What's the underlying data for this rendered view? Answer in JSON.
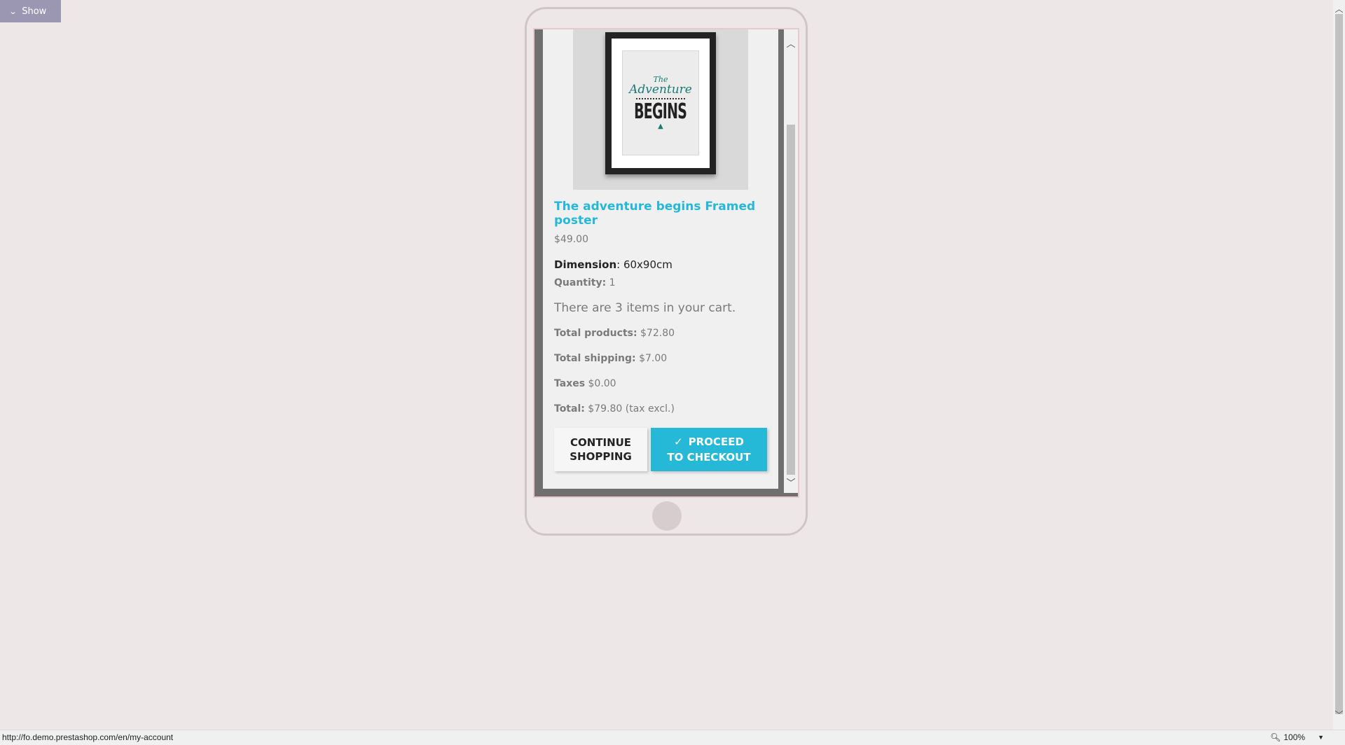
{
  "toolbar": {
    "show_label": "Show"
  },
  "product": {
    "art_line1": "The",
    "art_line2": "Adventure",
    "art_line3": "BEGINS",
    "name": "The adventure begins Framed poster",
    "price": "$49.00",
    "dimension_label": "Dimension",
    "dimension_value": ": 60x90cm",
    "quantity_label": "Quantity:",
    "quantity_value": " 1"
  },
  "cart": {
    "count_text": "There are 3 items in your cart.",
    "total_products_label": "Total products:",
    "total_products_value": " $72.80",
    "total_shipping_label": "Total shipping:",
    "total_shipping_value": " $7.00",
    "taxes_label": "Taxes",
    "taxes_value": " $0.00",
    "total_label": "Total:",
    "total_value": " $79.80 (tax excl.)"
  },
  "buttons": {
    "continue_line1": "CONTINUE",
    "continue_line2": "SHOPPING",
    "checkout_line1": "PROCEED",
    "checkout_line2": "TO CHECKOUT"
  },
  "status": {
    "url": "http://fo.demo.prestashop.com/en/my-account",
    "zoom": "100%"
  },
  "icons": {
    "show": "chevron-down-icon",
    "checkout": "check-icon",
    "zoom": "magnifier-icon"
  },
  "colors": {
    "accent": "#25b9d7",
    "show_button": "#9b97b3"
  }
}
